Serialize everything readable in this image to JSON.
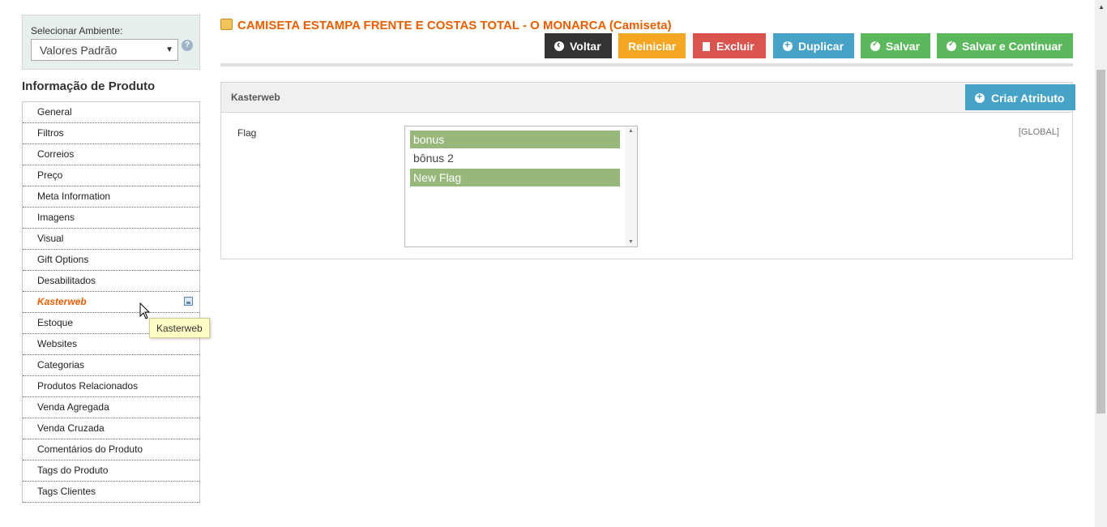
{
  "store_switcher": {
    "label": "Selecionar Ambiente:",
    "selected": "Valores Padrão",
    "help_icon": "question-circle-icon"
  },
  "nav": {
    "title": "Informação de Produto",
    "items": [
      {
        "label": "General",
        "active": false
      },
      {
        "label": "Filtros",
        "active": false
      },
      {
        "label": "Correios",
        "active": false
      },
      {
        "label": "Preço",
        "active": false
      },
      {
        "label": "Meta Information",
        "active": false
      },
      {
        "label": "Imagens",
        "active": false
      },
      {
        "label": "Visual",
        "active": false
      },
      {
        "label": "Gift Options",
        "active": false
      },
      {
        "label": "Desabilitados",
        "active": false
      },
      {
        "label": "Kasterweb",
        "active": true
      },
      {
        "label": "Estoque",
        "active": false
      },
      {
        "label": "Websites",
        "active": false
      },
      {
        "label": "Categorias",
        "active": false
      },
      {
        "label": "Produtos Relacionados",
        "active": false
      },
      {
        "label": "Venda Agregada",
        "active": false
      },
      {
        "label": "Venda Cruzada",
        "active": false
      },
      {
        "label": "Comentários do Produto",
        "active": false
      },
      {
        "label": "Tags do Produto",
        "active": false
      },
      {
        "label": "Tags Clientes",
        "active": false
      }
    ],
    "tooltip": "Kasterweb"
  },
  "header": {
    "title": "CAMISETA ESTAMPA FRENTE E COSTAS TOTAL - O MONARCA (Camiseta)",
    "title_icon": "product-box-icon",
    "buttons": {
      "back": "Voltar",
      "reset": "Reiniciar",
      "delete": "Excluir",
      "duplicate": "Duplicar",
      "save": "Salvar",
      "save_continue": "Salvar e Continuar"
    }
  },
  "section": {
    "title": "Kasterweb",
    "create_attribute": "Criar Atributo",
    "field": {
      "label": "Flag",
      "scope": "[GLOBAL]",
      "options": [
        {
          "label": "bonus",
          "selected": true
        },
        {
          "label": "bônus 2",
          "selected": false
        },
        {
          "label": "New Flag",
          "selected": true
        }
      ]
    }
  },
  "colors": {
    "accent_orange": "#eb5e00",
    "selected_option": "#98b77a",
    "btn_dark": "#333333",
    "btn_warning": "#f5a623",
    "btn_danger": "#d9534f",
    "btn_info": "#46a2c6",
    "btn_success": "#5cb85c"
  }
}
